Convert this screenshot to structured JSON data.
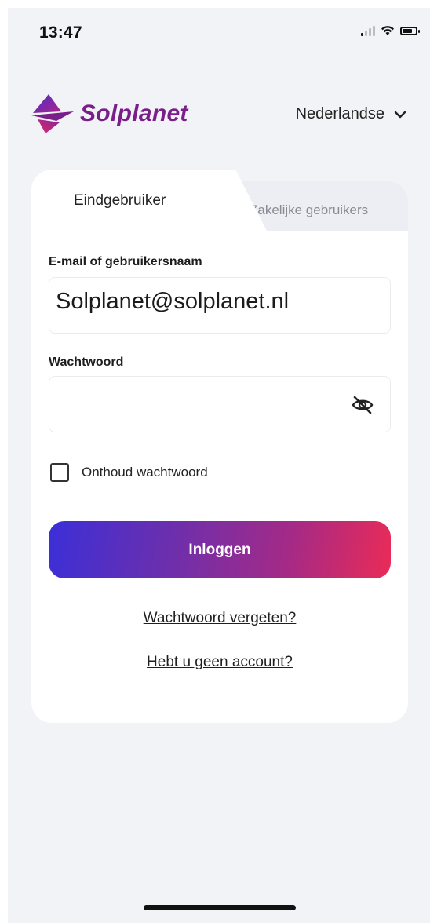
{
  "status_bar": {
    "time": "13:47"
  },
  "header": {
    "brand": "Solplanet",
    "language": "Nederlandse"
  },
  "tabs": [
    {
      "label": "Eindgebruiker",
      "active": true
    },
    {
      "label": "Zakelijke gebruikers",
      "active": false
    }
  ],
  "form": {
    "email_label": "E-mail of gebruikersnaam",
    "email_value": "Solplanet@solplanet.nl",
    "password_label": "Wachtwoord",
    "password_value": "",
    "remember_label": "Onthoud wachtwoord",
    "remember_checked": false,
    "login_label": "Inloggen",
    "forgot_label": "Wachtwoord vergeten?",
    "no_account_label": "Hebt u geen account?"
  },
  "colors": {
    "brand": "#7a1e8a",
    "button_start": "#3b2fd8",
    "button_end": "#ea2b57",
    "background": "#f2f3f7"
  },
  "icons": {
    "status": [
      "cellular-signal-icon",
      "wifi-icon",
      "battery-icon"
    ],
    "language": "chevron-down-icon",
    "password": "eye-off-icon",
    "logo": "solplanet-logo-icon"
  }
}
